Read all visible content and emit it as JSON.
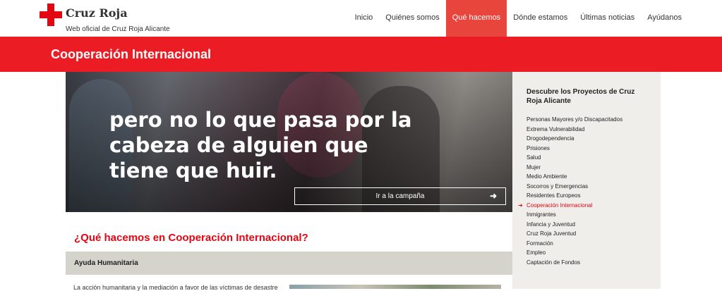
{
  "header": {
    "brand": "Cruz Roja",
    "tagline": "Web oficial de Cruz Roja Alicante",
    "nav": [
      {
        "label": "Inicio"
      },
      {
        "label": "Quiénes somos"
      },
      {
        "label": "Qué hacemos",
        "active": true
      },
      {
        "label": "Dónde estamos"
      },
      {
        "label": "Últimas noticias"
      },
      {
        "label": "Ayúdanos"
      }
    ]
  },
  "band": {
    "title": "Cooperación Internacional"
  },
  "hero": {
    "headline": "pero no lo que pasa por la cabeza de alguien que tiene que huir.",
    "button_label": "Ir a la campaña",
    "button_icon": "arrow-right-icon"
  },
  "main": {
    "section_title": "¿Qué hacemos en Cooperación Internacional?",
    "accordion_label": "Ayuda Humanitaria",
    "body_text": "La acción humanitaria y la mediación a favor de las víctimas de desastres y"
  },
  "sidebar": {
    "title": "Descubre los Proyectos de Cruz Roja Alicante",
    "items": [
      {
        "label": "Personas Mayores y/o Discapacitados"
      },
      {
        "label": "Extrema Vulnerabilidad"
      },
      {
        "label": "Drogodependencia"
      },
      {
        "label": "Prisiones"
      },
      {
        "label": "Salud"
      },
      {
        "label": "Mujer"
      },
      {
        "label": "Medio Ambiente"
      },
      {
        "label": "Socorros y Emergencias"
      },
      {
        "label": "Residentes Europeos"
      },
      {
        "label": "Cooperación Internacional",
        "active": true
      },
      {
        "label": "Inmigrantes"
      },
      {
        "label": "Infancia y Juventud"
      },
      {
        "label": "Cruz Roja Juventud"
      },
      {
        "label": "Formación"
      },
      {
        "label": "Empleo"
      },
      {
        "label": "Captación de Fondos"
      }
    ]
  },
  "colors": {
    "brand_red": "#ec1c24",
    "nav_active": "#e8453c",
    "sidebar_bg": "#efeeea",
    "accordion_bg": "#d4d3cc"
  }
}
